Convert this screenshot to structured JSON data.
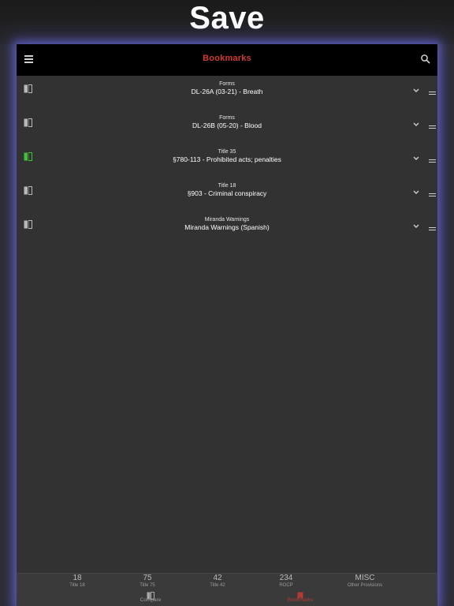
{
  "banner": {
    "title": "Save"
  },
  "header": {
    "title": "Bookmarks",
    "accent_color": "#d03a2f"
  },
  "bookmarks": [
    {
      "category": "Forms",
      "title": "DL-26A (03-21) - Breath",
      "icon_color": "#b8b8b8"
    },
    {
      "category": "Forms",
      "title": "DL-26B (05-20) - Blood",
      "icon_color": "#b8b8b8"
    },
    {
      "category": "Title 35",
      "title": "§780-113 - Prohibited acts; penalties",
      "icon_color": "#3fc23a"
    },
    {
      "category": "Title 18",
      "title": "§903 - Criminal conspiracy",
      "icon_color": "#b8b8b8"
    },
    {
      "category": "Miranda Warnings",
      "title": "Miranda Warnings (Spanish)",
      "icon_color": "#b8b8b8"
    }
  ],
  "tabs": [
    {
      "number": "18",
      "label": "Title 18"
    },
    {
      "number": "75",
      "label": "Title 75"
    },
    {
      "number": "42",
      "label": "Title 42"
    },
    {
      "number": "234",
      "label": "ROCP"
    },
    {
      "number": "MISC",
      "label": "Other Provisions"
    }
  ],
  "bottom_tabs": [
    {
      "label": "Compare",
      "icon": "compare-icon"
    },
    {
      "label": "Bookmarks",
      "icon": "bookmark-icon",
      "active": true
    }
  ],
  "icons": {
    "menu": "hamburger-menu-icon",
    "search": "search-icon",
    "row_icon": "document-compare-icon",
    "expand": "chevron-down-icon",
    "drag": "drag-handle-icon"
  }
}
